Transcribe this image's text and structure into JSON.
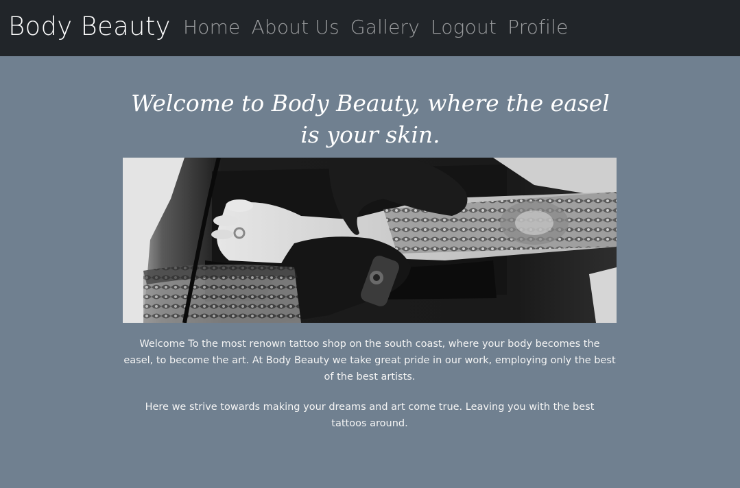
{
  "nav": {
    "brand": "Body Beauty",
    "links": [
      "Home",
      "About Us",
      "Gallery",
      "Logout",
      "Profile"
    ]
  },
  "main": {
    "heading": "Welcome to Body Beauty, where the easel is your skin.",
    "paragraphs": [
      "Welcome To the most renown tattoo shop on the south coast, where your body becomes the easel, to become the art. At Body Beauty we take great pride in our work, employing only the best of the best artists.",
      "Here we strive towards making your dreams and art come true. Leaving you with the best tattoos around."
    ]
  },
  "colors": {
    "navbar_bg": "#212529",
    "page_bg": "#708090",
    "nav_link": "rgba(255,255,255,0.55)"
  }
}
